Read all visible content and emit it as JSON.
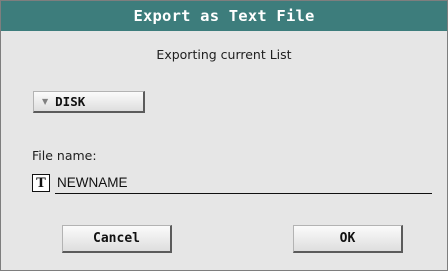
{
  "dialog": {
    "title": "Export as Text File",
    "subtitle": "Exporting current List"
  },
  "device_selector": {
    "arrow_icon": "triangle-down-icon",
    "value": "DISK"
  },
  "file_name": {
    "label": "File name:",
    "text_icon": "T",
    "value": "NEWNAME"
  },
  "buttons": {
    "cancel_label": "Cancel",
    "ok_label": "OK"
  },
  "colors": {
    "titlebar": "#3d7d7c",
    "dialog_bg": "#e6e6e6"
  }
}
